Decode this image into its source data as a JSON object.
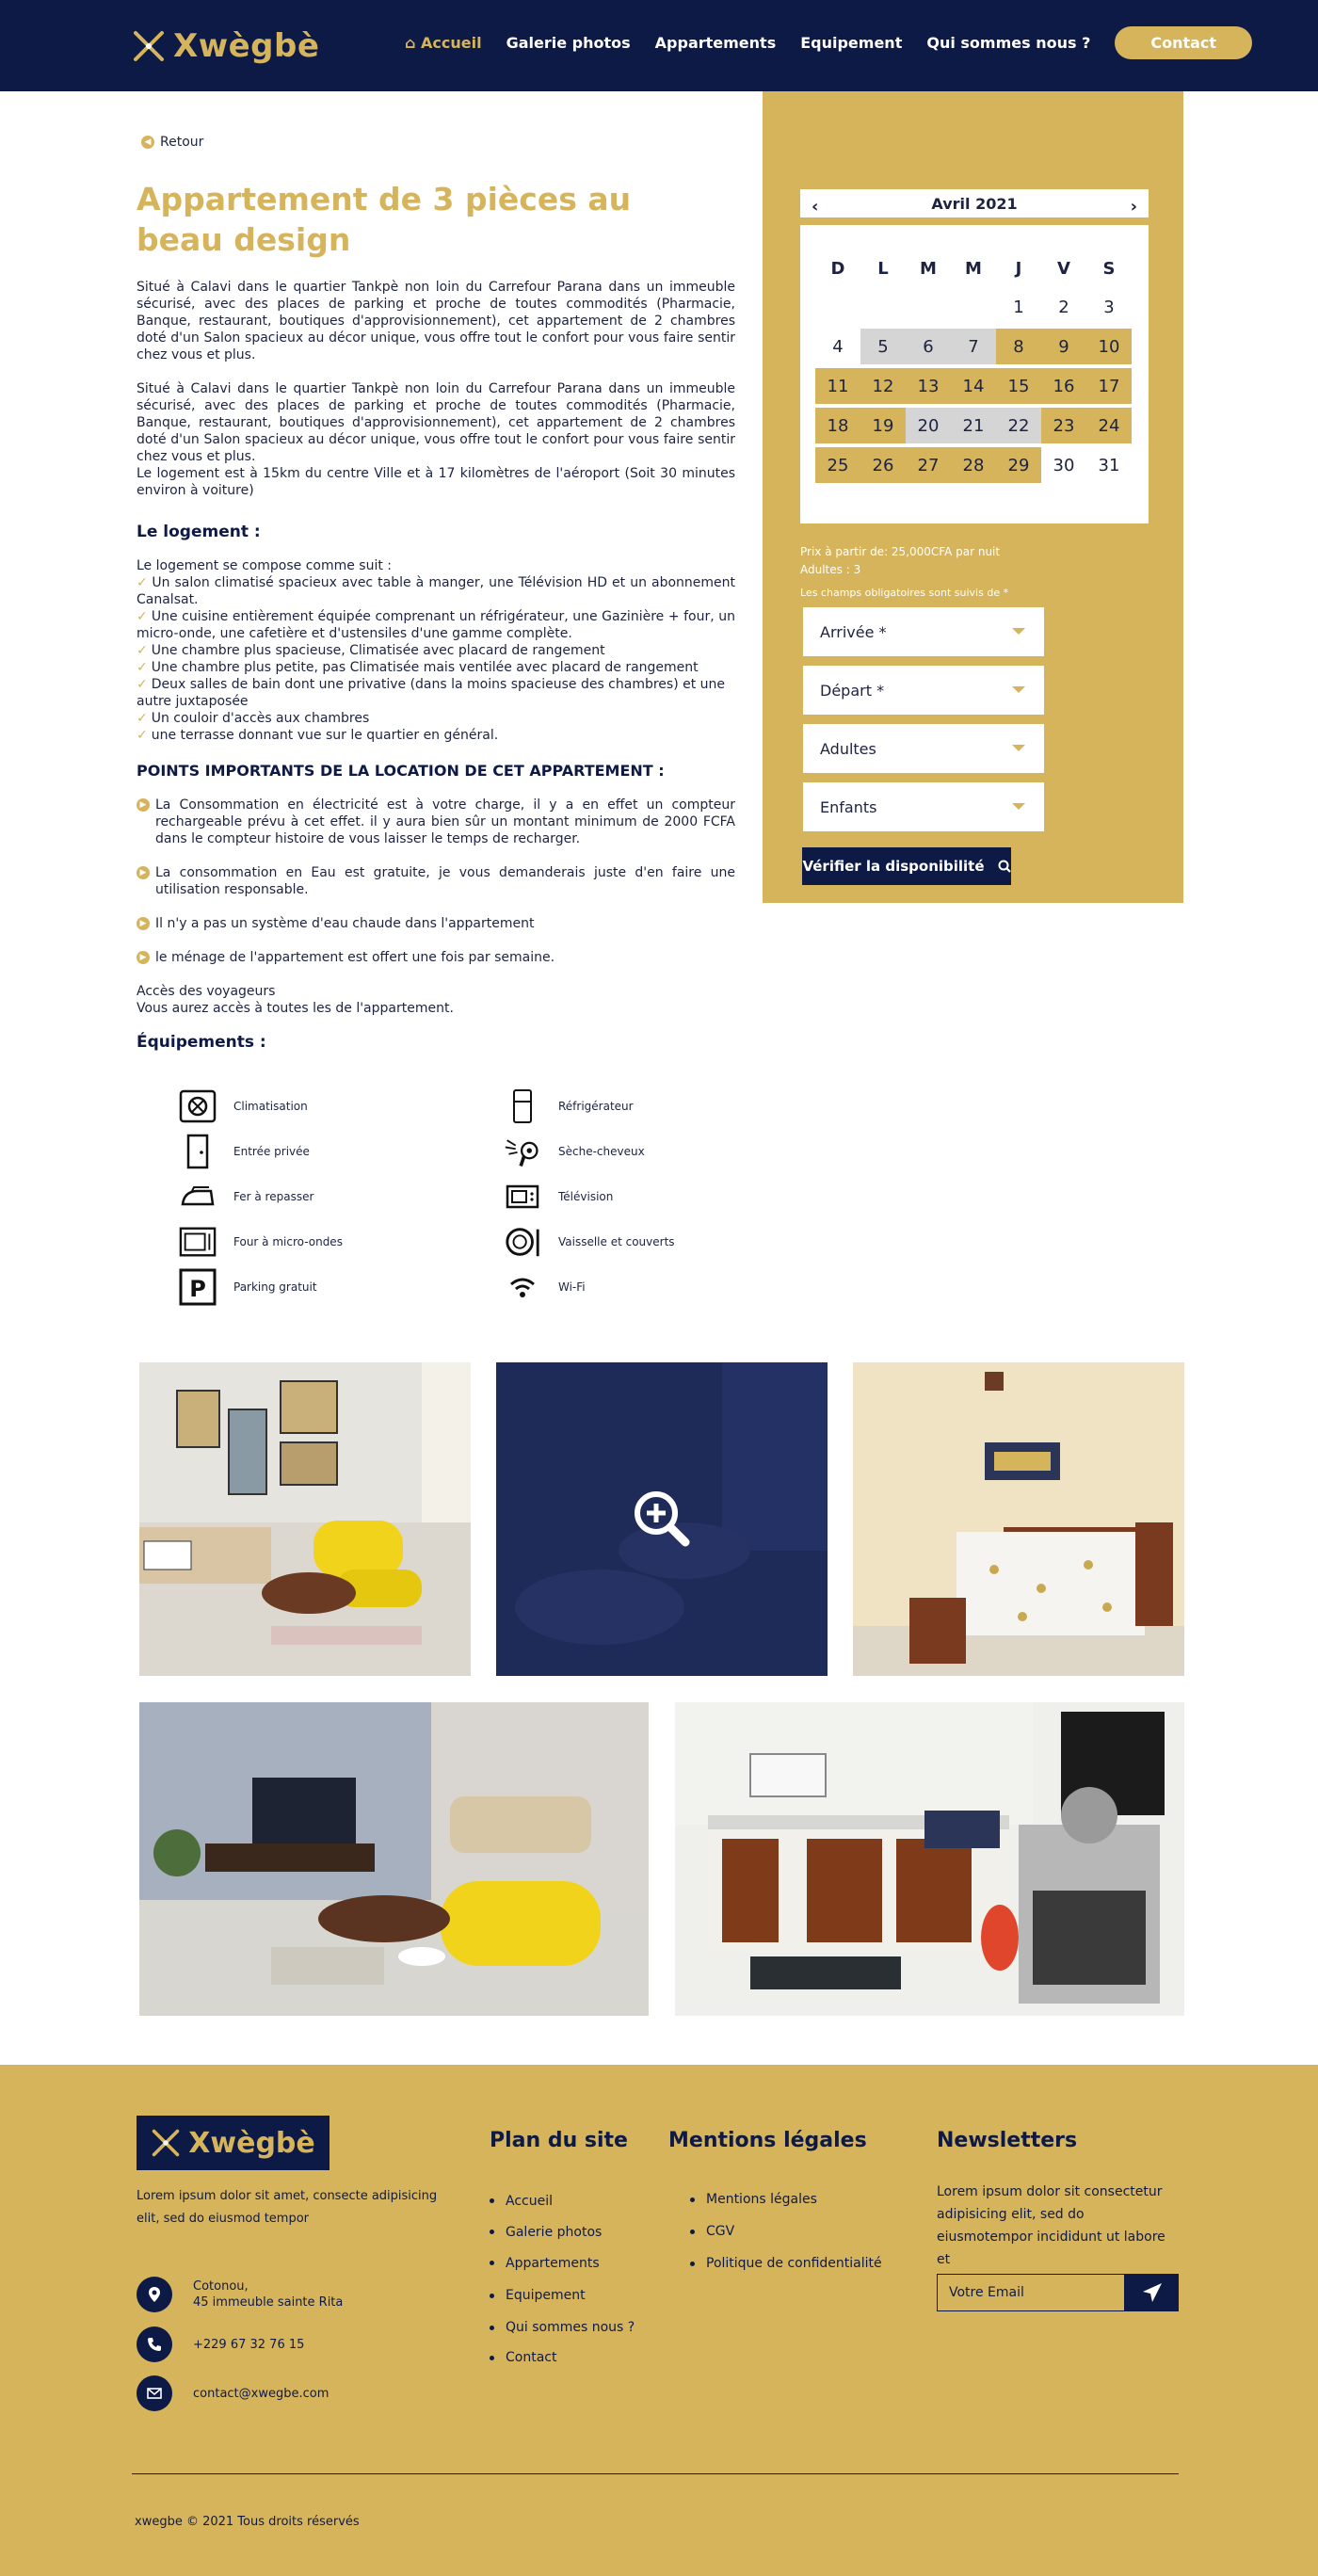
{
  "header": {
    "logo_text": "Xwègbè",
    "nav": [
      "Accueil",
      "Galerie photos",
      "Appartements",
      "Equipement",
      "Qui sommes nous ?"
    ],
    "contact_label": "Contact"
  },
  "back_label": "Retour",
  "title": "Appartement de 3 pièces au beau design",
  "paragraph1": "Situé à Calavi dans le quartier Tankpè non loin du Carrefour Parana dans un immeuble sécurisé, avec des places de parking et proche de toutes commodités (Pharmacie, Banque, restaurant, boutiques d'approvisionnement), cet appartement de 2 chambres doté d'un Salon spacieux au décor unique, vous offre tout le confort pour vous faire sentir chez vous et plus.",
  "paragraph2": "Situé à Calavi dans le quartier Tankpè non loin du Carrefour Parana dans un immeuble sécurisé, avec des places de parking et proche de toutes commodités (Pharmacie, Banque, restaurant, boutiques d'approvisionnement), cet appartement de 2 chambres doté d'un Salon spacieux au décor unique, vous offre tout le confort pour vous faire sentir chez vous et plus.",
  "paragraph2b": "Le logement est à 15km du centre Ville et à 17 kilomètres de l'aéroport (Soit 30 minutes environ à voiture)",
  "logement": {
    "heading": "Le logement :",
    "intro": "Le logement se compose comme suit :",
    "items": [
      "Un salon climatisé spacieux avec table à manger, une Télévision HD et un abonnement Canalsat.",
      "Une cuisine entièrement équipée comprenant un réfrigérateur, une Gazinière + four, un micro-onde, une cafetière et d'ustensiles d'une gamme complète.",
      "Une chambre plus spacieuse, Climatisée avec placard de rangement",
      "Une chambre plus petite, pas Climatisée mais ventilée avec placard de rangement",
      "Deux salles de bain dont une privative (dans la moins spacieuse des chambres) et une autre juxtaposée",
      "Un couloir d'accès aux chambres",
      "une terrasse donnant vue sur le quartier en général."
    ]
  },
  "points": {
    "heading": "POINTS IMPORTANTS DE LA LOCATION DE CET APPARTEMENT :",
    "items": [
      "La Consommation en électricité est à votre charge, il y a en effet un compteur rechargeable prévu à cet effet. il y aura bien sûr un montant minimum de 2000 FCFA dans le compteur histoire de vous laisser le temps de recharger.",
      "La consommation en Eau est gratuite, je vous demanderais juste d'en faire une utilisation responsable.",
      "Il n'y a pas un système d'eau chaude dans l'appartement",
      "le ménage de l'appartement est offert une fois par semaine."
    ]
  },
  "access": {
    "line1": "Accès des voyageurs",
    "line2": "Vous aurez accès à toutes les de l'appartement."
  },
  "equipements": {
    "heading": "Équipements :",
    "left": [
      "Climatisation",
      "Entrée privée",
      "Fer à repasser",
      "Four à micro-ondes",
      "Parking gratuit"
    ],
    "right": [
      "Réfrigérateur",
      "Sèche-cheveux",
      "Télévision",
      "Vaisselle et couverts",
      "Wi-Fi"
    ]
  },
  "calendar": {
    "month": "Avril 2021",
    "dow": [
      "D",
      "L",
      "M",
      "M",
      "J",
      "V",
      "S"
    ],
    "weeks": [
      [
        [
          "",
          " "
        ],
        [
          "",
          " "
        ],
        [
          "",
          " "
        ],
        [
          "",
          " "
        ],
        [
          "1",
          "w"
        ],
        [
          "2",
          "w"
        ],
        [
          "3",
          "w"
        ]
      ],
      [
        [
          "4",
          "w"
        ],
        [
          "5",
          "g"
        ],
        [
          "6",
          "g"
        ],
        [
          "7",
          "g"
        ],
        [
          "8",
          "y"
        ],
        [
          "9",
          "y"
        ],
        [
          "10",
          "y"
        ]
      ],
      [
        [
          "11",
          "y"
        ],
        [
          "12",
          "y"
        ],
        [
          "13",
          "y"
        ],
        [
          "14",
          "y"
        ],
        [
          "15",
          "y"
        ],
        [
          "16",
          "y"
        ],
        [
          "17",
          "y"
        ]
      ],
      [
        [
          "18",
          "y"
        ],
        [
          "19",
          "y"
        ],
        [
          "20",
          "g"
        ],
        [
          "21",
          "g"
        ],
        [
          "22",
          "g"
        ],
        [
          "23",
          "y"
        ],
        [
          "24",
          "y"
        ]
      ],
      [
        [
          "25",
          "y"
        ],
        [
          "26",
          "y"
        ],
        [
          "27",
          "y"
        ],
        [
          "28",
          "y"
        ],
        [
          "29",
          "y"
        ],
        [
          "30",
          "w"
        ],
        [
          "31",
          "w"
        ]
      ]
    ]
  },
  "booking": {
    "price": "Prix à partir de: 25,000CFA par nuit",
    "adults": "Adultes : 3",
    "required": "Les champs obligatoires sont suivis de *",
    "fields": [
      "Arrivée *",
      "Départ *",
      "Adultes",
      "Enfants"
    ],
    "verify": "Vérifier la disponibilité"
  },
  "footer": {
    "logo_text": "Xwègbè",
    "description": "Lorem ipsum dolor sit amet, consecte adipisicing elit, sed do eiusmod tempor",
    "address_line1": "Cotonou,",
    "address_line2": "45 immeuble sainte Rita",
    "phone": "+229 67 32 76 15",
    "email": "contact@xwegbe.com",
    "plan_title": "Plan du site",
    "plan_items": [
      "Accueil",
      "Galerie photos",
      "Appartements",
      "Equipement",
      "Qui sommes nous ?",
      "Contact"
    ],
    "legal_title": "Mentions légales",
    "legal_items": [
      "Mentions légales",
      "CGV",
      "Politique de confidentialité"
    ],
    "newsletter_title": "Newsletters",
    "newsletter_text": "Lorem ipsum dolor sit consectetur adipisicing elit, sed do eiusmotempor incididunt ut labore et",
    "email_placeholder": "Votre Email",
    "copyright": "xwegbe © 2021 Tous droits réservés"
  },
  "colors": {
    "navy": "#0e1a46",
    "gold": "#d6b45c",
    "gray": "#d5d5d5"
  }
}
